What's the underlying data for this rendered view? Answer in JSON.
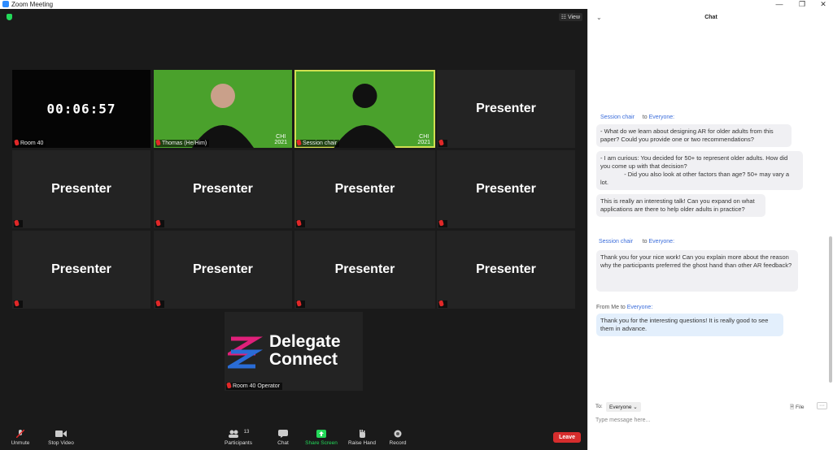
{
  "window": {
    "title": "Zoom Meeting"
  },
  "stage": {
    "view_label": "View",
    "timer": "00:06:57",
    "tiles": [
      {
        "label": "Room 40",
        "timer": true
      },
      {
        "label": "Thomas (He/Him)",
        "green": true
      },
      {
        "label": "Session chair",
        "green": true
      },
      {
        "label": "Presenter",
        "big": true
      },
      {
        "label": "Presenter",
        "big": true
      },
      {
        "label": "Presenter",
        "big": true
      },
      {
        "label": "Presenter",
        "big": true
      },
      {
        "label": "Presenter",
        "big": true
      },
      {
        "label": "Presenter",
        "big": true
      },
      {
        "label": "Presenter",
        "big": true
      },
      {
        "label": "Presenter",
        "big": true
      },
      {
        "label": "Presenter",
        "big": true
      }
    ],
    "chi_badge": "CHI\n2021",
    "operator": {
      "label": "Room 40 Operator",
      "logo_line1": "Delegate",
      "logo_line2": "Connect",
      "colors": {
        "pink": "#e0207a",
        "blue": "#2a6cd6"
      }
    }
  },
  "toolbar": {
    "unmute": "Unmute",
    "stop_video": "Stop Video",
    "participants": "Participants",
    "participants_count": "13",
    "chat": "Chat",
    "share_screen": "Share Screen",
    "raise_hand": "Raise Hand",
    "record": "Record",
    "leave": "Leave"
  },
  "chat": {
    "title": "Chat",
    "messages": [
      {
        "from": "Session chair",
        "to_prefix": "to",
        "to": "Everyone:",
        "lines": [
          "- What do we learn about designing AR for older adults from this paper? Could you provide one or two recommendations?",
          "- I am curious: You decided for 50+ to represent older adults. How did you come up with that decision?\n              - Did you also look at other factors than age? 50+ may vary a lot.",
          "This is really an interesting talk! Can you expand on what applications are there to help older adults in practice?"
        ]
      },
      {
        "from": "Session chair",
        "to_prefix": "to",
        "to": "Everyone:",
        "lines": [
          "Thank you for your nice work! Can you explain more about the reason why the participants preferred the ghost hand than other AR feedback?"
        ]
      },
      {
        "from": "From Me to",
        "to_prefix": "",
        "to": "Everyone:",
        "lines": [
          "Thank you for the interesting questions! It is really good to see them in advance."
        ]
      }
    ],
    "to_label": "To:",
    "to_value": "Everyone",
    "file_label": "File",
    "input_placeholder": "Type message here..."
  }
}
